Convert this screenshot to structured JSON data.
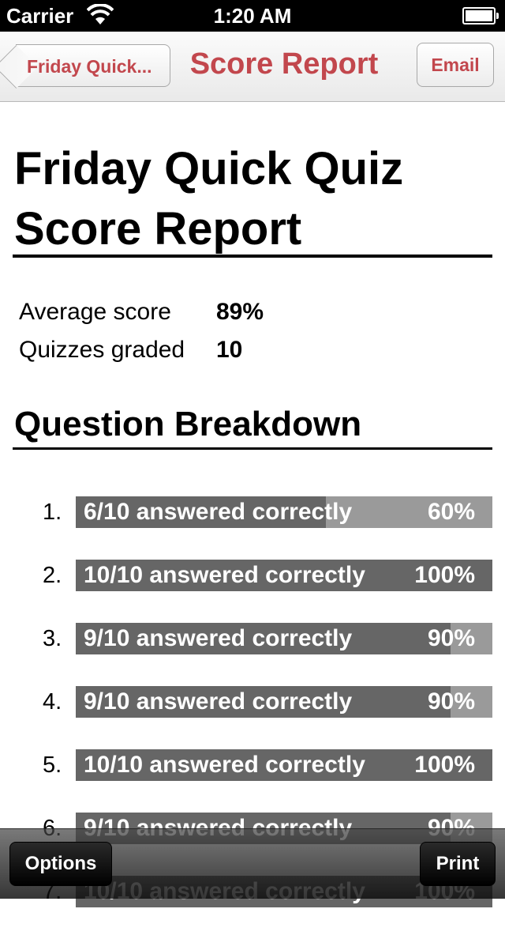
{
  "status_bar": {
    "carrier": "Carrier",
    "time": "1:20 AM"
  },
  "nav": {
    "back_label": "Friday Quick...",
    "title": "Score Report",
    "email_label": "Email",
    "accent_color": "#c2474d"
  },
  "report": {
    "title": "Friday Quick Quiz Score Report",
    "stats": [
      {
        "label": "Average score",
        "value": "89%"
      },
      {
        "label": "Quizzes graded",
        "value": "10"
      }
    ],
    "section_title": "Question Breakdown"
  },
  "questions": [
    {
      "number": "1.",
      "text": "6/10 answered correctly",
      "percent_label": "60%",
      "fraction": 0.6
    },
    {
      "number": "2.",
      "text": "10/10 answered correctly",
      "percent_label": "100%",
      "fraction": 1.0
    },
    {
      "number": "3.",
      "text": "9/10 answered correctly",
      "percent_label": "90%",
      "fraction": 0.9
    },
    {
      "number": "4.",
      "text": "9/10 answered correctly",
      "percent_label": "90%",
      "fraction": 0.9
    },
    {
      "number": "5.",
      "text": "10/10 answered correctly",
      "percent_label": "100%",
      "fraction": 1.0
    },
    {
      "number": "6.",
      "text": "9/10 answered correctly",
      "percent_label": "90%",
      "fraction": 0.9
    },
    {
      "number": "7.",
      "text": "10/10 answered correctly",
      "percent_label": "100%",
      "fraction": 1.0
    }
  ],
  "toolbar": {
    "options_label": "Options",
    "print_label": "Print"
  }
}
